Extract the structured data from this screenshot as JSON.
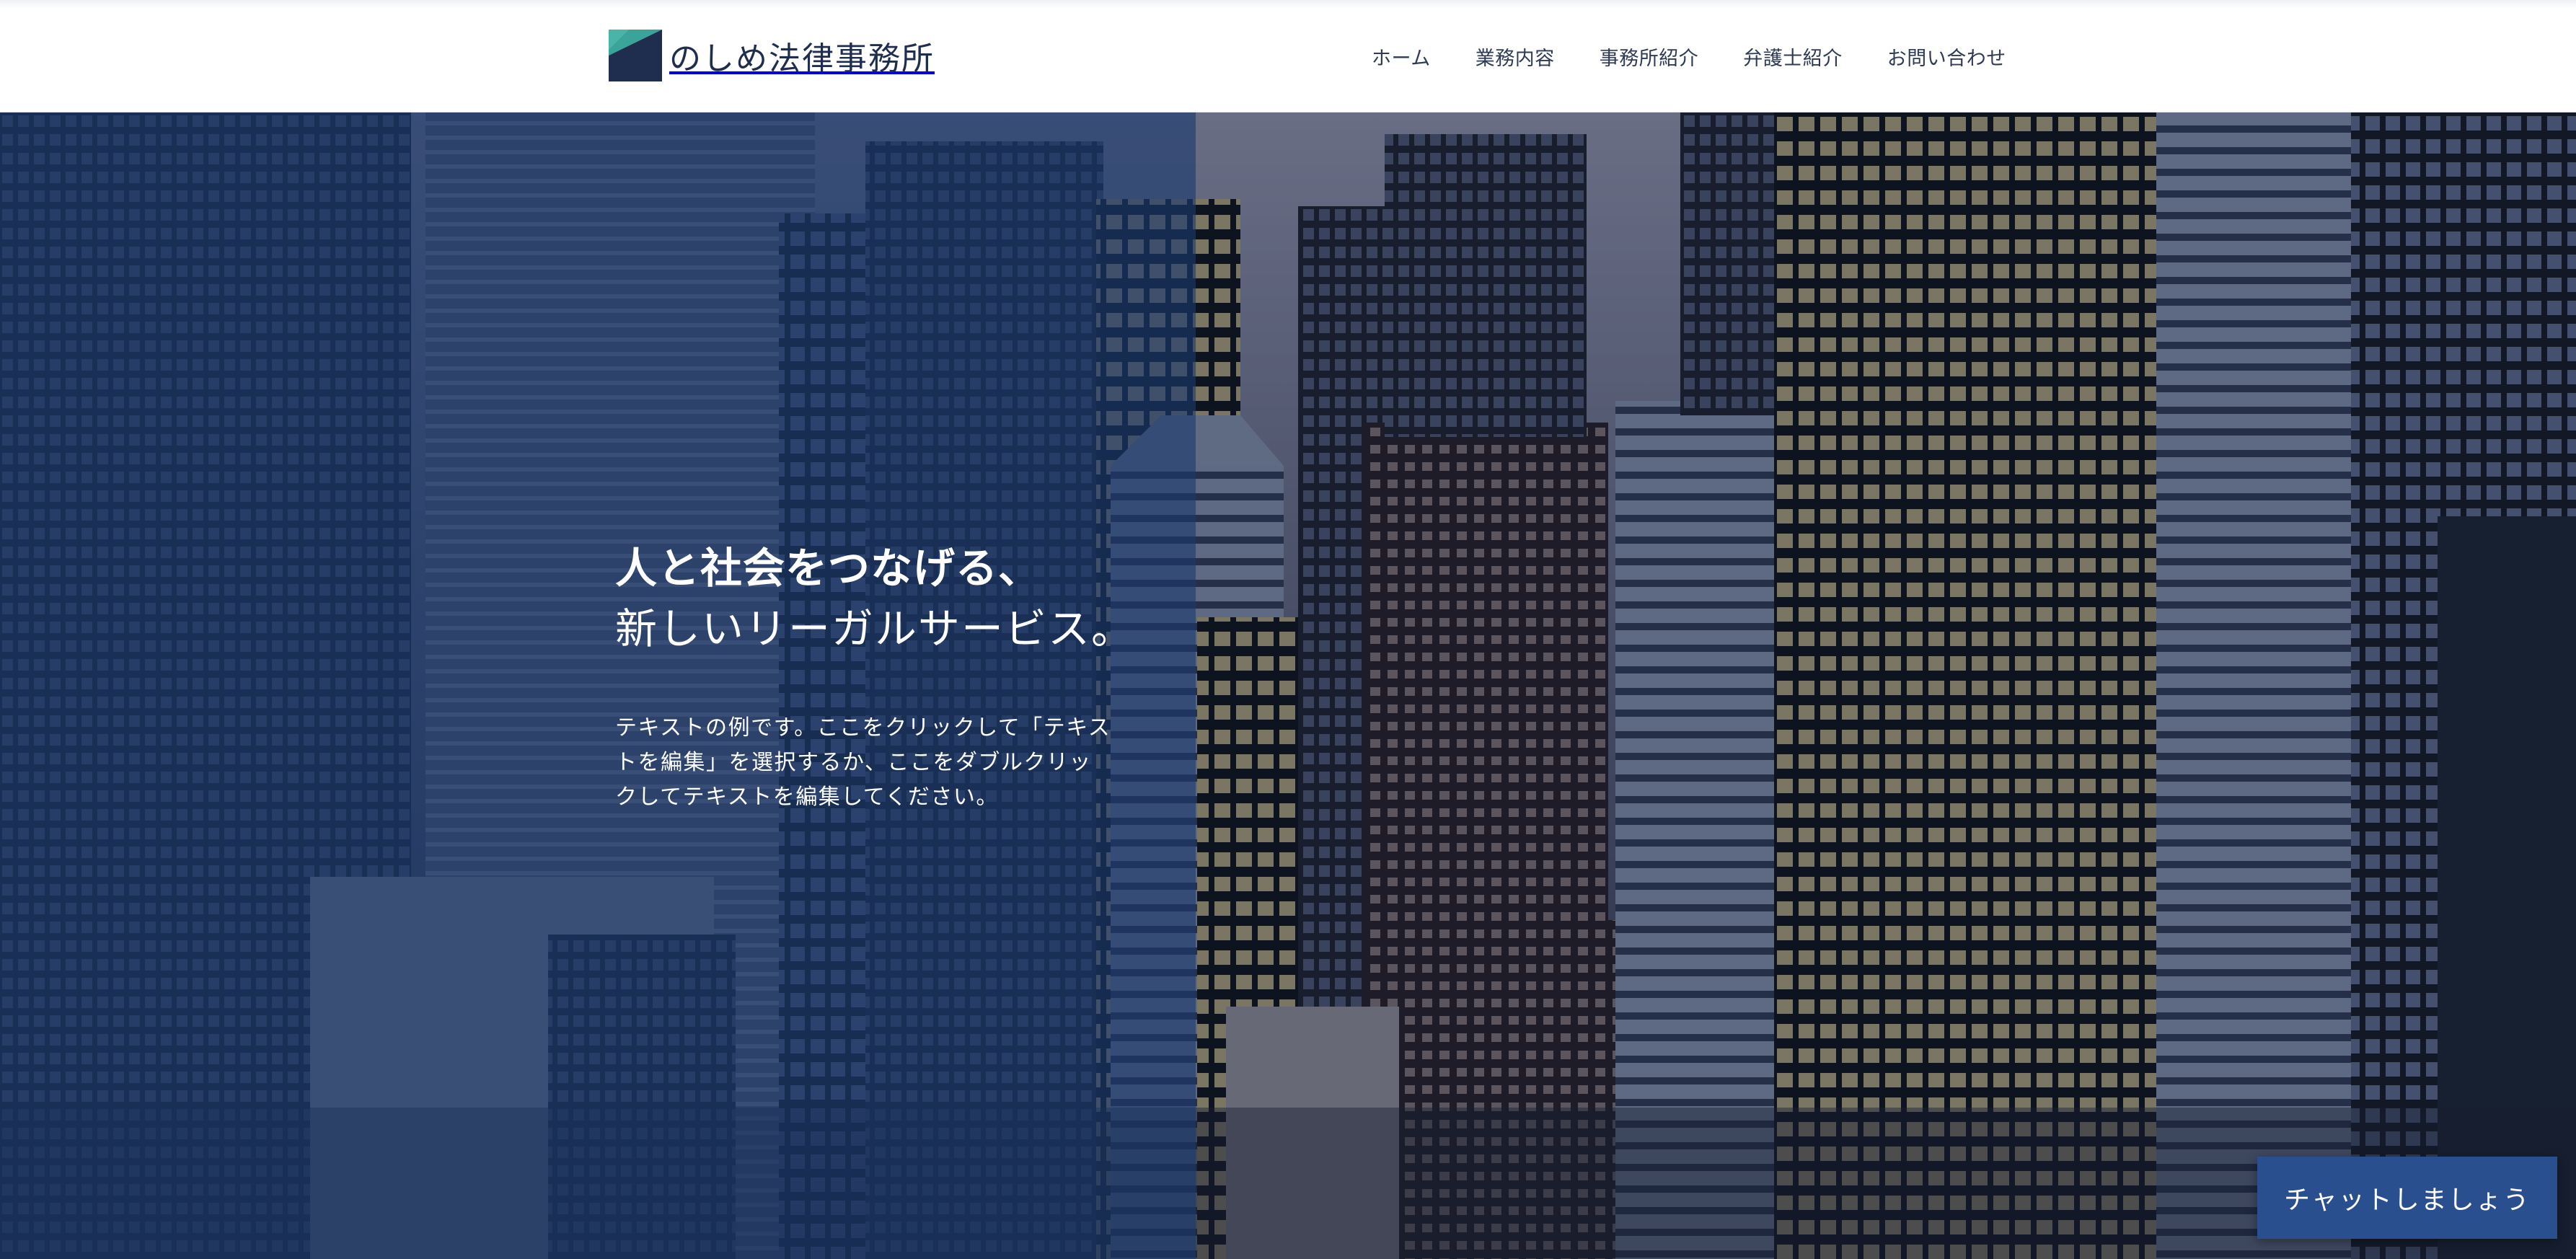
{
  "header": {
    "site_name": "のしめ法律事務所",
    "logo_icon": "k-logo-icon",
    "nav": [
      {
        "label": "ホーム"
      },
      {
        "label": "業務内容"
      },
      {
        "label": "事務所紹介"
      },
      {
        "label": "弁護士紹介"
      },
      {
        "label": "お問い合わせ"
      }
    ]
  },
  "hero": {
    "title_line1": "人と社会をつなげる、",
    "title_line2": "新しいリーガルサービス。",
    "body": "テキストの例です。ここをクリックして「テキストを編集」を選択するか、ここをダブルクリックしてテキストを編集してください。",
    "background": "city-skyline-photo"
  },
  "chat": {
    "label": "チャットしましょう"
  },
  "colors": {
    "brand_navy": "#1f2d4f",
    "brand_teal": "#3aa39a",
    "overlay_blue": "#1c3a6e",
    "chat_button": "#2a4f8f"
  }
}
